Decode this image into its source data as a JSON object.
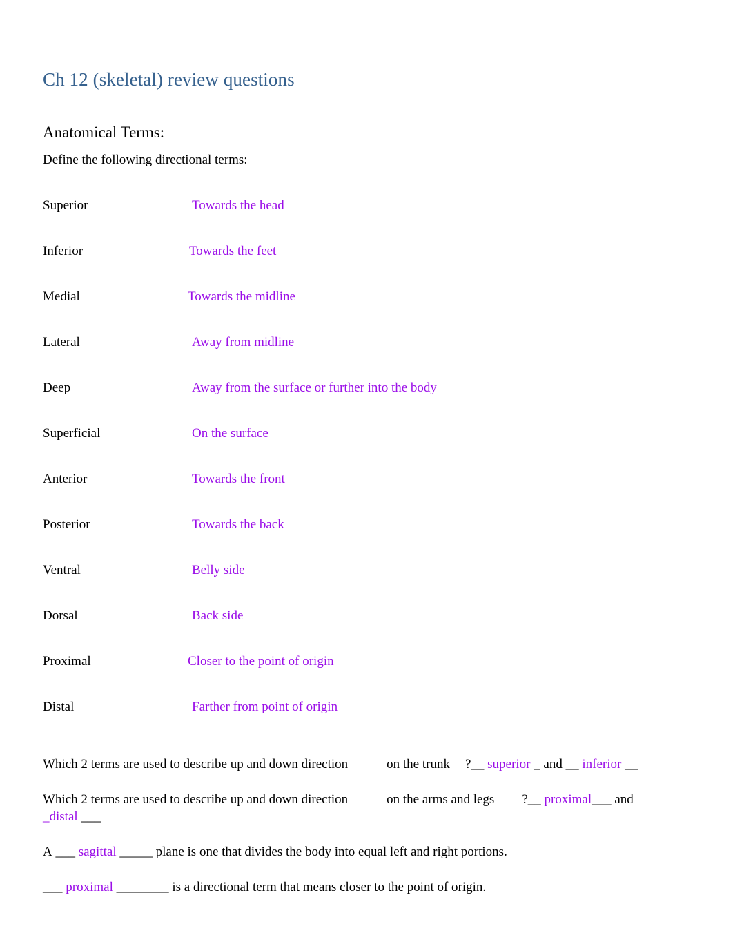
{
  "document": {
    "title": "Ch 12 (skeletal) review questions",
    "section_heading": "Anatomical Terms:",
    "instruction": "Define the following directional terms:",
    "title_color": "#36618e",
    "answer_color": "#9b0fe8",
    "body_color": "#000000",
    "background": "#ffffff"
  },
  "terms": [
    {
      "label": "Superior",
      "definition": "Towards the head",
      "offset": 216
    },
    {
      "label": "Inferior",
      "definition": "Towards the feet",
      "offset": 212
    },
    {
      "label": "Medial",
      "definition": "Towards the midline",
      "offset": 210
    },
    {
      "label": "Lateral",
      "definition": "Away from midline",
      "offset": 216
    },
    {
      "label": "Deep",
      "definition": "Away from the surface or further into the body",
      "offset": 216
    },
    {
      "label": "Superficial",
      "definition": "On the surface",
      "offset": 216
    },
    {
      "label": "Anterior",
      "definition": "Towards the front",
      "offset": 216
    },
    {
      "label": "Posterior",
      "definition": "Towards the back",
      "offset": 216
    },
    {
      "label": "Ventral",
      "definition": "Belly side",
      "offset": 216
    },
    {
      "label": "Dorsal",
      "definition": "Back side",
      "offset": 216
    },
    {
      "label": "Proximal",
      "definition": "Closer to the point of origin",
      "offset": 210
    },
    {
      "label": "Distal",
      "definition": "Farther from point of origin",
      "offset": 216
    }
  ],
  "questions": {
    "q1": {
      "stem": "Which 2 terms are used to describe up and down direction",
      "context": "on the trunk",
      "marker": "?",
      "blank1": "__",
      "answer1": "superior",
      "blank2": "_",
      "conjunction": "and",
      "blank3": "__",
      "answer2": "inferior",
      "blank4": "__"
    },
    "q2": {
      "stem": "Which 2 terms are used to describe up and down direction",
      "context": "on the arms and legs",
      "marker": "?",
      "blank1": "__",
      "answer1": "proximal",
      "blank2": "___",
      "conjunction": "and",
      "blank3": "_",
      "answer2": "distal",
      "blank4": "___"
    },
    "q3": {
      "prefix": "A",
      "blank1": "___",
      "answer": "sagittal",
      "blank2": "_____",
      "suffix": "plane is one that divides the body into equal left and right portions."
    },
    "q4": {
      "blank1": "___",
      "answer": "proximal",
      "blank2": "________",
      "suffix": "is a directional term that means closer to the point of origin."
    }
  }
}
